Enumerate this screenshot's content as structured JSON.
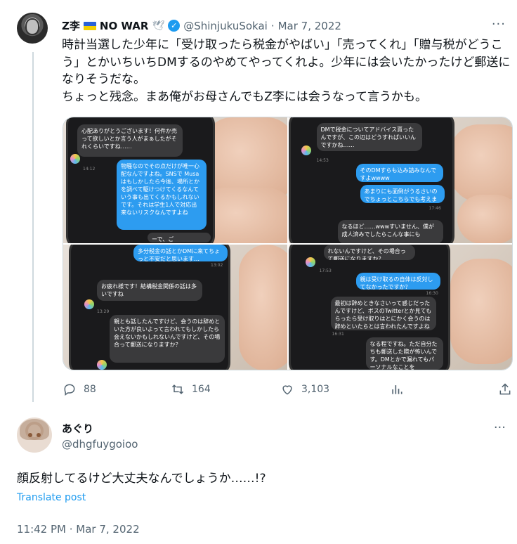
{
  "tweet": {
    "author_name": "Z李",
    "author_name_suffix": "NO WAR",
    "dove_glyph": "🕊",
    "handle": "@ShinjukuSokai",
    "separator": "·",
    "date": "Mar 7, 2022",
    "verified_glyph": "✓",
    "more_glyph": "···",
    "text": "時計当選した少年に「受け取ったら税金がやばい」「売ってくれ」「贈与税がどうこう」とかいちいちDMするのやめてやってくれよ。少年には会いたかったけど郵送になりそうだな。\nちょっと残念。まあ俺がお母さんでもZ李には会うなって言うかも。",
    "flag_colors": [
      "#2a62d9",
      "#f4d000"
    ],
    "media": [
      {
        "bubbles": [
          {
            "style": "gray",
            "text": "心配ありがとうございます！何件か売って欲しいとか言う人がまぁしたがそれくらいですね……"
          },
          {
            "style": "blue",
            "text": "物騒なのでその点だけが唯一心配なんですよね。SNSで Musaはもしかしたら今後、場所とかを調べて駆けつけてくるなんていう事も出てくるかもしれないです。それは学生1人で対応出来ないリスクなんですよね"
          },
          {
            "style": "gray",
            "text": "ーで、ご"
          }
        ],
        "times": [
          "14:12"
        ]
      },
      {
        "bubbles": [
          {
            "style": "gray",
            "text": "DMで税金についてアドバイス貰ったんですが、この辺はどうすればいいんですかね……"
          },
          {
            "style": "blue",
            "text": "そのDMすらも込み詰みなんですよwwww"
          },
          {
            "style": "blue",
            "text": "あまりにも面倒がうるさいのでちょっとこちらでも考えますね！"
          },
          {
            "style": "gray",
            "text": "なるほど……wwwすいません、僕が成人済みでしたらこんな事にも"
          }
        ],
        "times": [
          "14:53",
          "17:46"
        ]
      },
      {
        "bubbles": [
          {
            "style": "blue",
            "text": "多分税金の話とかDMに来てちょっと不安だと思います…"
          },
          {
            "style": "gray",
            "text": "お疲れ様です！結構税金関係の話は多いですね"
          },
          {
            "style": "gray",
            "text": "親とも話したんですけど、会うのは辞めといた方が良いよって言われてもしかしたら会えないかもしれないんですけど、その場合って郵送になりますか？"
          }
        ],
        "times": [
          "13:02",
          "13:29"
        ]
      },
      {
        "bubbles": [
          {
            "style": "gray",
            "text": "れないんですけど、その場合って郵送になりますか？"
          },
          {
            "style": "blue",
            "text": "親は受け取るの自体は反対してなかったですか？"
          },
          {
            "style": "gray",
            "text": "最初は辞めときなさいって感じだったんですけど、ボスのTwitterとか見てもらったら受け取りはとにかく会うのは辞めといたらとは言われたんですよね"
          },
          {
            "style": "gray",
            "text": "なる程ですね。ただ自分たちも郵送した際が怖いんです。DMとかで漏れてもパーソナルなことを"
          }
        ],
        "times": [
          "17:53",
          "16:30",
          "16:31"
        ]
      }
    ],
    "actions": {
      "reply_count": "88",
      "retweet_count": "164",
      "like_count": "3,103"
    }
  },
  "reply": {
    "author_name": "あぐり",
    "handle": "@dhgfuygoioo",
    "more_glyph": "···",
    "text": "顔反射してるけど大丈夫なんでしょうか……!?",
    "translate_label": "Translate post",
    "timestamp": "11:42 PM · Mar 7, 2022"
  }
}
